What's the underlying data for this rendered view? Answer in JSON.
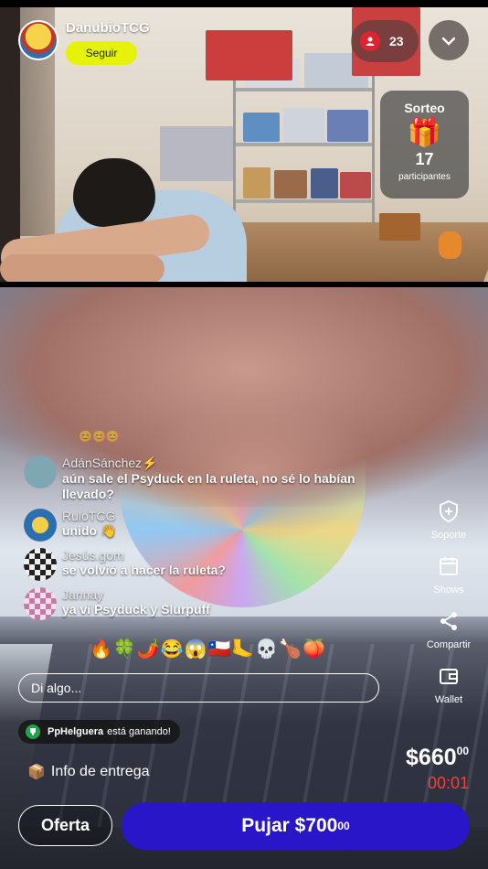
{
  "host": {
    "name": "DanubioTCG",
    "follow_label": "Seguir"
  },
  "viewers": {
    "count": "23"
  },
  "giveaway": {
    "title": "Sorteo",
    "count": "17",
    "subtitle": "participantes"
  },
  "chat": {
    "messages": [
      {
        "user": "AdánSánchez⚡",
        "text": "aún sale el Psyduck en la ruleta, no sé lo habían llevado?",
        "avatar_color": "#7fa7b3"
      },
      {
        "user": "RuloTCG",
        "text": "unido 👋",
        "avatar_color": "#2c6fb0"
      },
      {
        "user": "Jesús.gom",
        "text": "se volvió a hacer la ruleta?",
        "avatar_color": "#444444"
      },
      {
        "user": "Jannay",
        "text": "ya vi Psyduck y Slurpuff",
        "avatar_color": "#c27aa6"
      }
    ],
    "input_placeholder": "Di algo..."
  },
  "reactions": "🔥🍀🌶️😂😱🇨🇱🦶💀🍗🍑",
  "winning": {
    "user": "PpHelguera",
    "text": "está ganando!"
  },
  "delivery": {
    "label": "Info de entrega"
  },
  "price": {
    "main": "$660",
    "cents": "00",
    "timer": "00:01"
  },
  "buttons": {
    "offer": "Oferta",
    "bid": "Pujar $700",
    "bid_cents": "00"
  },
  "side_actions": [
    {
      "label": "Soporte",
      "icon": "support-icon"
    },
    {
      "label": "Shows",
      "icon": "calendar-icon"
    },
    {
      "label": "Compartir",
      "icon": "share-icon"
    },
    {
      "label": "Wallet",
      "icon": "wallet-icon"
    }
  ],
  "colors": {
    "follow": "#e6f20a",
    "bid": "#2a16c9",
    "timer": "#ff3b3b",
    "viewers_badge": "#e0242f"
  }
}
